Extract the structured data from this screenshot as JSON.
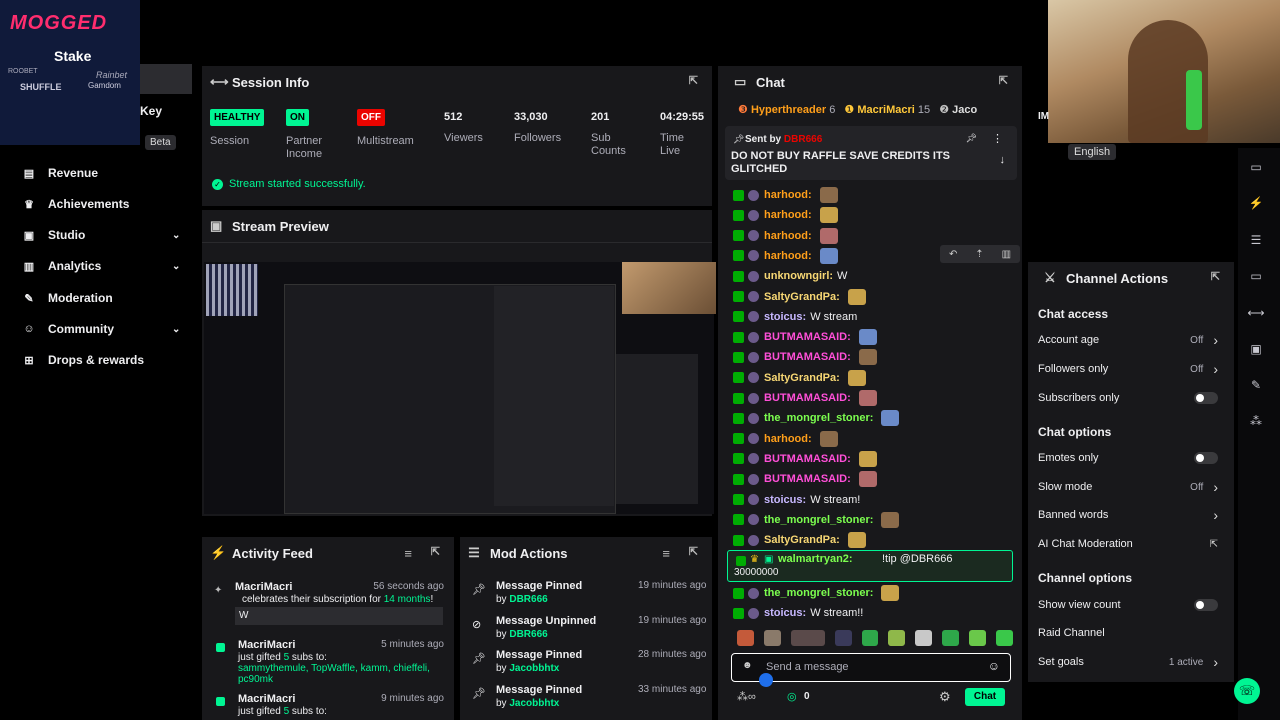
{
  "sponsor": {
    "brand": "MOGGED",
    "stake": "Stake",
    "roobet": "ROOBET",
    "shuffle": "SHUFFLE",
    "gamdom": "Gamdom",
    "rainbet": "Rainbet"
  },
  "sidebar": {
    "partial_key": "Key",
    "partial_item": "Achievements",
    "beta": "Beta",
    "items": [
      {
        "label": "Revenue",
        "icon": "revenue-icon",
        "expandable": false
      },
      {
        "label": "Achievements",
        "icon": "trophy-icon",
        "expandable": false
      },
      {
        "label": "Studio",
        "icon": "studio-icon",
        "expandable": true
      },
      {
        "label": "Analytics",
        "icon": "analytics-icon",
        "expandable": true
      },
      {
        "label": "Moderation",
        "icon": "wrench-icon",
        "expandable": false
      },
      {
        "label": "Community",
        "icon": "community-icon",
        "expandable": true
      },
      {
        "label": "Drops & rewards",
        "icon": "drops-icon",
        "expandable": false
      }
    ]
  },
  "session": {
    "title": "Session Info",
    "stats": [
      {
        "badge": "HEALTHY",
        "badge_color": "#00f593",
        "label": "Session"
      },
      {
        "badge": "ON",
        "badge_color": "#00f593",
        "label": "Partner Income"
      },
      {
        "badge": "OFF",
        "badge_color": "#eb0400",
        "label": "Multistream"
      },
      {
        "value": "512",
        "label": "Viewers"
      },
      {
        "value": "33,030",
        "label": "Followers"
      },
      {
        "value": "201",
        "label": "Sub Counts"
      },
      {
        "value": "04:29:55",
        "label": "Time Live"
      }
    ],
    "success": "Stream started successfully."
  },
  "preview": {
    "title": "Stream Preview"
  },
  "activity": {
    "title": "Activity Feed",
    "items": [
      {
        "name": "MacriMacri",
        "time": "56 seconds ago",
        "text1": "celebrates their subscription for ",
        "highlight": "14 months",
        "text2": "!",
        "message": "W"
      },
      {
        "name": "MacriMacri",
        "time": "5 minutes ago",
        "text1": "just gifted ",
        "highlight": "5",
        "text2": " subs to:",
        "recipients": "sammythemule, TopWaffle, kamm, chieffeli, pc90mk"
      },
      {
        "name": "MacriMacri",
        "time": "9 minutes ago",
        "text1": "just gifted ",
        "highlight": "5",
        "text2": " subs to:"
      }
    ]
  },
  "mod": {
    "title": "Mod Actions",
    "items": [
      {
        "action": "Message Pinned",
        "by": "by",
        "user": "DBR666",
        "time": "19 minutes ago",
        "icon": "pin-icon"
      },
      {
        "action": "Message Unpinned",
        "by": "by",
        "user": "DBR666",
        "time": "19 minutes ago",
        "icon": "unpin-icon"
      },
      {
        "action": "Message Pinned",
        "by": "by",
        "user": "Jacobbhtx",
        "time": "28 minutes ago",
        "icon": "pin-icon"
      },
      {
        "action": "Message Pinned",
        "by": "by",
        "user": "Jacobbhtx",
        "time": "33 minutes ago",
        "icon": "pin-icon"
      }
    ]
  },
  "chat": {
    "title": "Chat",
    "leaderboard": [
      {
        "name": "Hyperthreader",
        "count": "6"
      },
      {
        "name": "MacriMacri",
        "count": "15"
      },
      {
        "name": "Jaco",
        "count": ""
      }
    ],
    "pinned": {
      "sent_by": "Sent by",
      "user": "DBR666",
      "text": "DO NOT BUY RAFFLE SAVE CREDITS ITS GLITCHED"
    },
    "messages": [
      {
        "user": "harhood:",
        "color": "#ff9f1a",
        "text": "",
        "emote": true
      },
      {
        "user": "harhood:",
        "color": "#ff9f1a",
        "text": "",
        "emote": true
      },
      {
        "user": "harhood:",
        "color": "#ff9f1a",
        "text": "",
        "emote": true
      },
      {
        "user": "harhood:",
        "color": "#ff9f1a",
        "text": "",
        "emote": true
      },
      {
        "user": "unknowngirl:",
        "color": "#f7d774",
        "text": "W",
        "emote": false
      },
      {
        "user": "SaltyGrandPa:",
        "color": "#f7d774",
        "text": "",
        "emote": true
      },
      {
        "user": "stoicus:",
        "color": "#c7b8ff",
        "text": "W stream",
        "emote": false
      },
      {
        "user": "BUTMAMASAID:",
        "color": "#ff4fd8",
        "text": "",
        "emote": true
      },
      {
        "user": "BUTMAMASAID:",
        "color": "#ff4fd8",
        "text": "",
        "emote": true
      },
      {
        "user": "SaltyGrandPa:",
        "color": "#f7d774",
        "text": "",
        "emote": true
      },
      {
        "user": "BUTMAMASAID:",
        "color": "#ff4fd8",
        "text": "",
        "emote": true
      },
      {
        "user": "the_mongrel_stoner:",
        "color": "#7cff4f",
        "text": "",
        "emote": true
      },
      {
        "user": "harhood:",
        "color": "#ff9f1a",
        "text": "",
        "emote": true
      },
      {
        "user": "BUTMAMASAID:",
        "color": "#ff4fd8",
        "text": "",
        "emote": true
      },
      {
        "user": "BUTMAMASAID:",
        "color": "#ff4fd8",
        "text": "",
        "emote": true
      },
      {
        "user": "stoicus:",
        "color": "#c7b8ff",
        "text": "W stream!",
        "emote": false
      },
      {
        "user": "the_mongrel_stoner:",
        "color": "#7cff4f",
        "text": "",
        "emote": true
      },
      {
        "user": "SaltyGrandPa:",
        "color": "#f7d774",
        "text": "",
        "emote": true
      }
    ],
    "tip": {
      "user": "walmartryan2:",
      "text": "!tip @DBR666",
      "amount": "30000000"
    },
    "after": [
      {
        "user": "the_mongrel_stoner:",
        "color": "#7cff4f",
        "text": "",
        "emote": true
      },
      {
        "user": "stoicus:",
        "color": "#c7b8ff",
        "text": "W stream!!",
        "emote": false
      }
    ],
    "input_placeholder": "Send a message",
    "points": "0",
    "chat_button": "Chat"
  },
  "webcam": {
    "language": "English",
    "partial": "IM"
  },
  "channel_actions": {
    "title": "Channel Actions",
    "sections": [
      {
        "title": "Chat access",
        "rows": [
          {
            "label": "Account age",
            "value": "Off",
            "control": "chevron"
          },
          {
            "label": "Followers only",
            "value": "Off",
            "control": "chevron"
          },
          {
            "label": "Subscribers only",
            "value": "",
            "control": "toggle"
          }
        ]
      },
      {
        "title": "Chat options",
        "rows": [
          {
            "label": "Emotes only",
            "value": "",
            "control": "toggle"
          },
          {
            "label": "Slow mode",
            "value": "Off",
            "control": "chevron"
          },
          {
            "label": "Banned words",
            "value": "",
            "control": "chevron"
          },
          {
            "label": "AI Chat Moderation",
            "value": "",
            "control": "external"
          }
        ]
      },
      {
        "title": "Channel options",
        "rows": [
          {
            "label": "Show view count",
            "value": "",
            "control": "toggle"
          },
          {
            "label": "Raid Channel",
            "value": "",
            "control": "none"
          },
          {
            "label": "Set goals",
            "value": "1 active",
            "control": "chevron"
          }
        ]
      }
    ]
  },
  "colors": {
    "accent": "#00f593",
    "panel": "#18181b",
    "danger": "#eb0400"
  }
}
